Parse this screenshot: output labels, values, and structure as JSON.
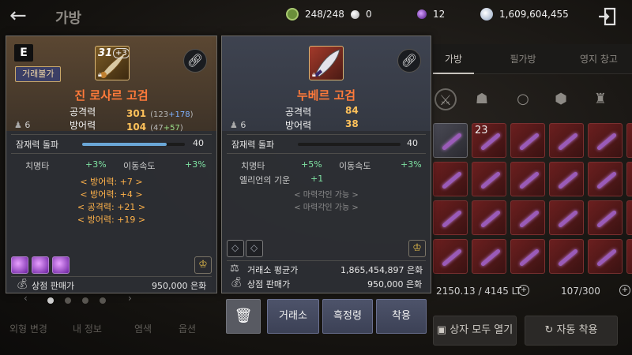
{
  "header": {
    "title": "가방",
    "resources": [
      {
        "icon": "stamina-icon",
        "value": "248/248",
        "color": "#6a8f3a"
      },
      {
        "icon": "pearl-icon",
        "value": "0",
        "color": "#d8d8d8"
      },
      {
        "icon": "crystal-icon",
        "value": "12",
        "color": "#8a3fd0"
      },
      {
        "icon": "silver-icon",
        "value": "1,609,604,455",
        "color": "#c8d4e4"
      }
    ]
  },
  "inventory": {
    "tabs": [
      "가방",
      "필가방",
      "영지 창고"
    ],
    "active_tab": "가방",
    "slot_count_label": "23",
    "weight": "2150.13 / 4145 LT",
    "capacity": "107/300",
    "buttons": {
      "open_all": "상자 모두 열기",
      "auto_equip": "자동 착용"
    },
    "left_tabs": [
      "외형 변경",
      "내 정보",
      "염색",
      "옵션"
    ]
  },
  "item_left": {
    "grade": "E",
    "untradable": "거래불가",
    "level": "31",
    "enhance": "+3",
    "name": "진 로사르 고검",
    "lock_count": "6",
    "attack_label": "공격력",
    "attack_value": "301",
    "attack_sub_open": "(123",
    "attack_sub_plus": "+178",
    "attack_sub_close": ")",
    "defense_label": "방어력",
    "defense_value": "104",
    "defense_sub_open": "(47",
    "defense_sub_plus": "+57",
    "defense_sub_close": ")",
    "potential_label": "잠재력 돌파",
    "potential_value": "40",
    "potential_fraction": 0.82,
    "sub_stats": [
      {
        "label": "치명타",
        "value": "+3%"
      },
      {
        "label": "이동속도",
        "value": "+3%"
      }
    ],
    "options": [
      "< 방어력: +7 >",
      "< 방어력: +4 >",
      "< 공격력: +21 >",
      "< 방어력: +19 >"
    ],
    "sell_label": "상점 판매가",
    "sell_value": "950,000 은화"
  },
  "item_right": {
    "name": "누베르 고검",
    "lock_count": "6",
    "attack_label": "공격력",
    "attack_value": "84",
    "defense_label": "방어력",
    "defense_value": "38",
    "potential_label": "잠재력 돌파",
    "potential_value": "40",
    "potential_fraction": 0.0,
    "sub_stats": [
      {
        "label": "치명타",
        "value": "+5%"
      },
      {
        "label": "이동속도",
        "value": "+3%"
      },
      {
        "label": "엘리언의 기운",
        "value": "+1"
      }
    ],
    "options": [
      "< 마력각인 가능 >",
      "< 마력각인 가능 >"
    ],
    "market_label": "거래소 평균가",
    "market_value": "1,865,454,897 은화",
    "sell_label": "상점 판매가",
    "sell_value": "950,000 은화"
  },
  "actions": {
    "market": "거래소",
    "black_spirit": "흑정령",
    "equip": "착용"
  }
}
